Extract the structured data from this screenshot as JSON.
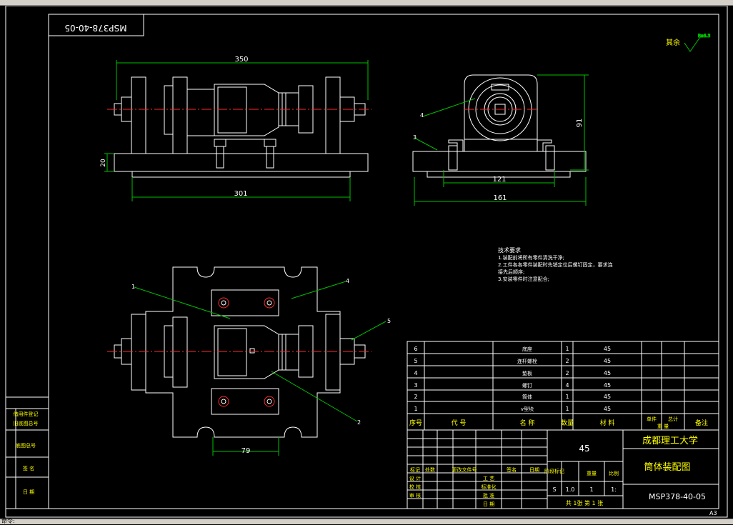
{
  "drawing_code_mirrored": "MSP378-40-05",
  "surface_finish": {
    "label": "其余",
    "value": "Ra6.3"
  },
  "dims": {
    "front_width": "350",
    "front_base": "301",
    "front_height": "20",
    "side_121": "121",
    "side_161": "161",
    "side_91": "91",
    "plan_79": "79"
  },
  "leaders": {
    "l1": "1",
    "l2": "2",
    "l3": "3",
    "l4a": "4",
    "l4b": "4",
    "l5": "5"
  },
  "tech_req": {
    "title": "技术要求",
    "lines": [
      "1.装配前将所有零件清洗干净;",
      "2.工件各各零件装配时先销定位后螺钉固定，要求连",
      "接先后顺序;",
      "3.安装零件时注意配合;"
    ]
  },
  "bom": {
    "rows": [
      {
        "no": "6",
        "name": "底座",
        "qty": "1",
        "mat": "45"
      },
      {
        "no": "5",
        "name": "连杆螺栓",
        "qty": "2",
        "mat": "45"
      },
      {
        "no": "4",
        "name": "垫板",
        "qty": "2",
        "mat": "45"
      },
      {
        "no": "3",
        "name": "螺钉",
        "qty": "4",
        "mat": "45"
      },
      {
        "no": "2",
        "name": "筒体",
        "qty": "1",
        "mat": "45"
      },
      {
        "no": "1",
        "name": "v型块",
        "qty": "1",
        "mat": "45"
      }
    ],
    "header": {
      "no": "序号",
      "code": "代 号",
      "name": "名 称",
      "qty": "数量",
      "mat": "材 料",
      "unit": "单件",
      "total": "总计",
      "weight": "重 量",
      "note": "备注"
    }
  },
  "title_block": {
    "material": "45",
    "university": "成都理工大学",
    "drawing_name": "筒体装配图",
    "drawing_code": "MSP378-40-05",
    "sheet": "共 1张 第 1 张",
    "rev_labels": [
      "标记",
      "处数",
      "更改文件号",
      "签名",
      "日期"
    ],
    "roles": [
      "设 计",
      "校 核",
      "审 核"
    ],
    "roles2": [
      "工 艺",
      "标准化",
      "批 准",
      "日 期"
    ],
    "stage": "阶段标记",
    "weight": "重量",
    "scale": "比例",
    "stage_val": "S",
    "weight_val": "1.0",
    "weight_val2": "1",
    "scale_val": "1:"
  },
  "side_block": [
    "借用件登记",
    "旧底图总号",
    "底图总号",
    "签 名",
    "日 期"
  ],
  "sheet_size": "A3",
  "status_text": "命令:"
}
